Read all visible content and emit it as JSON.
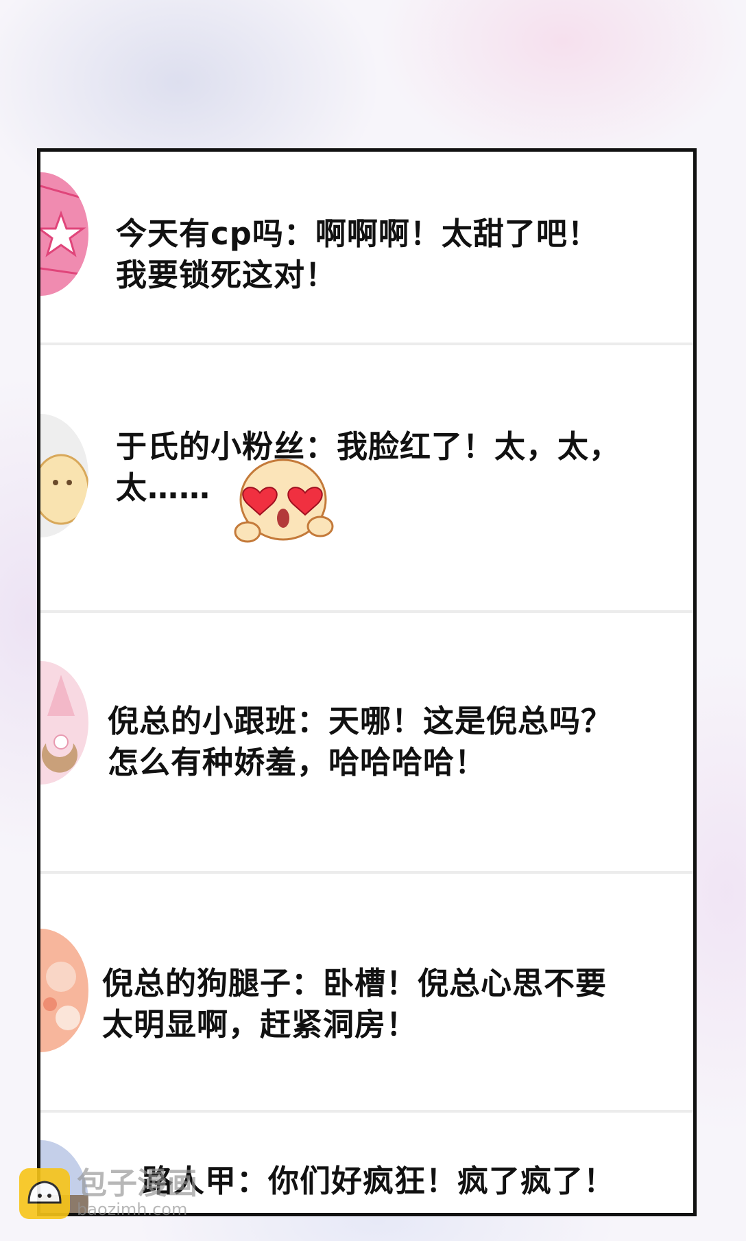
{
  "comments": [
    {
      "text_line1": "今天有cp吗：啊啊啊！太甜了吧！",
      "text_line2": "我要锁死这对！",
      "avatar": "pink-star-avatar"
    },
    {
      "text_line1": "于氏的小粉丝：我脸红了！太，太，",
      "text_line2": "太……",
      "avatar": "cream-bun-avatar",
      "emoji": "heart-eyes-bun-emoji"
    },
    {
      "text_line1": "倪总的小跟班：天哪！这是倪总吗？",
      "text_line2": "怎么有种娇羞，哈哈哈哈！",
      "avatar": "pink-moon-avatar"
    },
    {
      "text_line1": "倪总的狗腿子：卧槽！倪总心思不要",
      "text_line2": "太明显啊，赶紧洞房！",
      "avatar": "peach-flower-avatar"
    },
    {
      "text_line1": "路人甲：你们好疯狂！疯了疯了！",
      "text_line2": "",
      "avatar": "blue-avatar"
    }
  ],
  "watermark": {
    "name": "包子漫画",
    "url": "baozimh.com"
  }
}
